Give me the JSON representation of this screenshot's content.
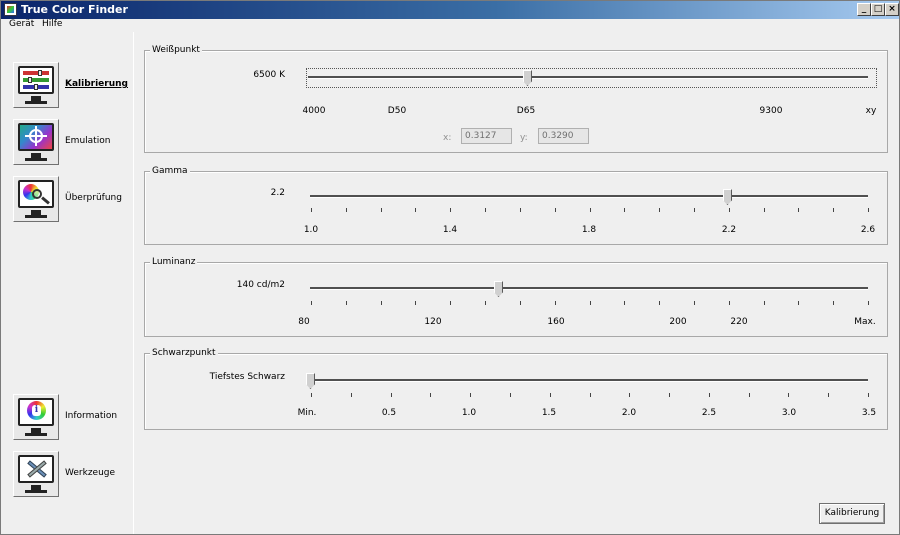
{
  "window": {
    "title": "True Color Finder",
    "controls": [
      "_",
      "□",
      "×"
    ]
  },
  "menu": [
    "Gerät",
    "Hilfe"
  ],
  "sidebar": {
    "items": [
      {
        "label": "Kalibrierung",
        "icon": "calibration-icon",
        "active": true
      },
      {
        "label": "Emulation",
        "icon": "emulation-icon",
        "active": false
      },
      {
        "label": "Überprüfung",
        "icon": "verification-icon",
        "active": false
      },
      {
        "label": "Information",
        "icon": "information-icon",
        "active": false
      },
      {
        "label": "Werkzeuge",
        "icon": "tools-icon",
        "active": false
      }
    ]
  },
  "whitepoint": {
    "title": "Weißpunkt",
    "value_label": "6500 K",
    "tick_labels": [
      "4000",
      "D50",
      "D65",
      "9300",
      "xy"
    ],
    "x_label": "x:",
    "x_value": "0.3127",
    "y_label": "y:",
    "y_value": "0.3290"
  },
  "gamma": {
    "title": "Gamma",
    "value_label": "2.2",
    "tick_labels": [
      "1.0",
      "1.4",
      "1.8",
      "2.2",
      "2.6"
    ]
  },
  "luminance": {
    "title": "Luminanz",
    "value_label": "140 cd/m2",
    "tick_labels": [
      "80",
      "120",
      "160",
      "200",
      "220",
      "Max."
    ]
  },
  "blackpoint": {
    "title": "Schwarzpunkt",
    "value_label": "Tiefstes Schwarz",
    "tick_labels": [
      "Min.",
      "0.5",
      "1.0",
      "1.5",
      "2.0",
      "2.5",
      "3.0",
      "3.5"
    ]
  },
  "actions": {
    "calibrate_label": "Kalibrierung"
  },
  "colors": {
    "title_bar_start": "#0a246a",
    "title_bar_end": "#a6caf0",
    "window_bg": "#efefef"
  }
}
